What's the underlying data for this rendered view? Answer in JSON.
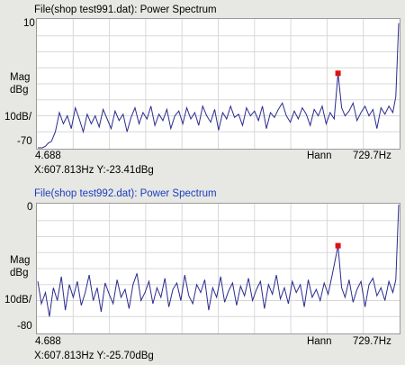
{
  "panels": [
    {
      "title": "File(shop test991.dat): Power Spectrum",
      "title_color": "#000000",
      "y_max_label": "10",
      "y_min_label": "-70",
      "y_unit_line1": "Mag",
      "y_unit_line2": "dBg",
      "y_scale_label": "10dB/",
      "x_start_label": "4.688",
      "window_label": "Hann",
      "x_end_label": "729.7Hz",
      "readout": "X:607.813Hz Y:-23.41dBg"
    },
    {
      "title": "File(shop test992.dat): Power Spectrum",
      "title_color": "#1a3fbf",
      "y_max_label": "0",
      "y_min_label": "-80",
      "y_unit_line1": "Mag",
      "y_unit_line2": "dBg",
      "y_scale_label": "10dB/",
      "x_start_label": "4.688",
      "window_label": "Hann",
      "x_end_label": "729.7Hz",
      "readout": "X:607.813Hz Y:-25.70dBg"
    }
  ],
  "chart_data": [
    {
      "type": "line",
      "title": "File(shop test991.dat): Power Spectrum",
      "xlabel": "Hz",
      "ylabel": "Mag dBg",
      "xlim": [
        4.688,
        729.7
      ],
      "ylim": [
        -70,
        10
      ],
      "grid": true,
      "line_color": "#2b2b8f",
      "marker_color": "#e01010",
      "marker": {
        "x": 607.813,
        "y": -23.41
      },
      "series": [
        {
          "x": [
            4.688,
            14,
            20,
            26,
            32,
            40,
            48,
            56,
            64,
            72,
            80,
            88,
            96,
            104,
            112,
            120,
            128,
            136,
            144,
            152,
            160,
            168,
            176,
            184,
            192,
            200,
            208,
            216,
            224,
            232,
            240,
            248,
            256,
            264,
            272,
            280,
            288,
            296,
            304,
            312,
            320,
            328,
            336,
            344,
            352,
            360,
            368,
            376,
            384,
            392,
            400,
            408,
            416,
            424,
            432,
            440,
            448,
            456,
            464,
            472,
            480,
            488,
            496,
            504,
            512,
            520,
            528,
            536,
            544,
            552,
            560,
            568,
            576,
            584,
            592,
            600,
            607.813,
            615,
            622,
            630,
            638,
            646,
            654,
            662,
            670,
            678,
            686,
            694,
            702,
            710,
            718,
            724,
            729.7
          ],
          "values": [
            -70,
            -70,
            -69,
            -67,
            -66,
            -60,
            -48,
            -55,
            -50,
            -58,
            -45,
            -52,
            -60,
            -49,
            -55,
            -50,
            -57,
            -46,
            -52,
            -58,
            -47,
            -53,
            -49,
            -60,
            -51,
            -45,
            -55,
            -48,
            -52,
            -44,
            -56,
            -49,
            -53,
            -46,
            -58,
            -50,
            -47,
            -55,
            -45,
            -52,
            -48,
            -56,
            -44,
            -50,
            -54,
            -46,
            -59,
            -48,
            -52,
            -44,
            -51,
            -49,
            -56,
            -45,
            -50,
            -47,
            -53,
            -44,
            -58,
            -48,
            -51,
            -46,
            -42,
            -50,
            -54,
            -47,
            -52,
            -45,
            -49,
            -56,
            -46,
            -50,
            -44,
            -55,
            -48,
            -52,
            -23.41,
            -45,
            -50,
            -47,
            -42,
            -53,
            -48,
            -44,
            -50,
            -46,
            -58,
            -45,
            -49,
            -44,
            -48,
            -38,
            8
          ]
        }
      ]
    },
    {
      "type": "line",
      "title": "File(shop test992.dat): Power Spectrum",
      "xlabel": "Hz",
      "ylabel": "Mag dBg",
      "xlim": [
        4.688,
        729.7
      ],
      "ylim": [
        -80,
        0
      ],
      "grid": true,
      "line_color": "#2b2b8f",
      "marker_color": "#e01010",
      "marker": {
        "x": 607.813,
        "y": -25.7
      },
      "series": [
        {
          "x": [
            4.688,
            12,
            20,
            28,
            36,
            44,
            52,
            60,
            68,
            76,
            84,
            92,
            100,
            108,
            116,
            124,
            132,
            140,
            148,
            156,
            164,
            172,
            180,
            188,
            196,
            204,
            212,
            220,
            228,
            236,
            244,
            252,
            260,
            268,
            276,
            284,
            292,
            300,
            308,
            316,
            324,
            332,
            340,
            348,
            356,
            364,
            372,
            380,
            388,
            396,
            404,
            412,
            420,
            428,
            436,
            444,
            452,
            460,
            468,
            476,
            484,
            492,
            500,
            508,
            516,
            524,
            532,
            540,
            548,
            556,
            564,
            572,
            580,
            588,
            596,
            607.813,
            615,
            622,
            630,
            638,
            646,
            654,
            662,
            670,
            678,
            686,
            694,
            702,
            710,
            718,
            724,
            729.7
          ],
          "values": [
            -48,
            -62,
            -55,
            -70,
            -52,
            -60,
            -45,
            -66,
            -50,
            -58,
            -48,
            -63,
            -55,
            -44,
            -60,
            -52,
            -67,
            -49,
            -56,
            -62,
            -47,
            -58,
            -53,
            -65,
            -50,
            -43,
            -60,
            -55,
            -48,
            -62,
            -52,
            -58,
            -46,
            -64,
            -53,
            -49,
            -60,
            -44,
            -57,
            -62,
            -50,
            -55,
            -47,
            -66,
            -52,
            -58,
            -45,
            -61,
            -54,
            -49,
            -63,
            -51,
            -57,
            -46,
            -60,
            -53,
            -48,
            -65,
            -50,
            -56,
            -44,
            -59,
            -52,
            -62,
            -48,
            -55,
            -50,
            -64,
            -47,
            -58,
            -53,
            -60,
            -49,
            -56,
            -44,
            -25.7,
            -52,
            -58,
            -47,
            -61,
            -53,
            -48,
            -64,
            -50,
            -46,
            -57,
            -52,
            -60,
            -48,
            -55,
            -47,
            0
          ]
        }
      ]
    }
  ]
}
